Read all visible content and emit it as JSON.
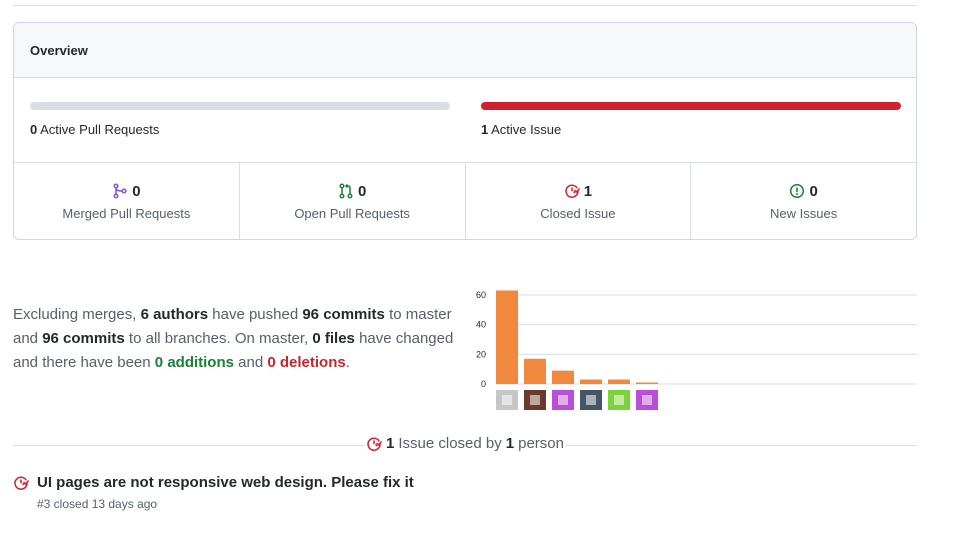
{
  "overview": {
    "title": "Overview",
    "pull_requests_bar": {
      "count": "0",
      "label": "Active Pull Requests",
      "fraction": 0
    },
    "issues_bar": {
      "count": "1",
      "label": "Active Issue",
      "fraction": 1,
      "color": "#cf222e"
    },
    "stats": [
      {
        "icon": "merged-pr-icon",
        "color": "#8250df",
        "value": "0",
        "label": "Merged Pull Requests"
      },
      {
        "icon": "open-pr-icon",
        "color": "#1a7f37",
        "value": "0",
        "label": "Open Pull Requests"
      },
      {
        "icon": "closed-issue-icon",
        "color": "#cf222e",
        "value": "1",
        "label": "Closed Issue"
      },
      {
        "icon": "new-issue-icon",
        "color": "#1a7f37",
        "value": "0",
        "label": "New Issues"
      }
    ]
  },
  "summary": {
    "p1": "Excluding merges,",
    "authors": "6 authors",
    "p2": "have pushed",
    "commits1": "96 commits",
    "p3": "to master and",
    "commits2": "96 commits",
    "p4": "to all branches. On master,",
    "files": "0 files",
    "p5": "have changed and there have been",
    "additions_num": "0",
    "additions_word": "additions",
    "p6": "and",
    "deletions_num": "0",
    "deletions_word": "deletions",
    "p7": "."
  },
  "chart_data": {
    "type": "bar",
    "categories": [
      "author-1",
      "author-2",
      "author-3",
      "author-4",
      "author-5",
      "author-6"
    ],
    "values": [
      63,
      17,
      9,
      3,
      3,
      1
    ],
    "ylim": [
      0,
      65
    ],
    "yticks": [
      "0",
      "20",
      "40",
      "60"
    ],
    "grid": true,
    "bar_color": "#f0883e",
    "avatar_colors": [
      "#c6c6c6",
      "#6b3a2a",
      "#b84fd6",
      "#445566",
      "#7ad33a",
      "#b84fd6"
    ]
  },
  "closed_section": {
    "count": "1",
    "text_mid": "Issue closed by",
    "people": "1",
    "text_end": "person"
  },
  "issue": {
    "title": "UI pages are not responsive web design. Please fix it",
    "meta": "#3 closed 13 days ago"
  }
}
